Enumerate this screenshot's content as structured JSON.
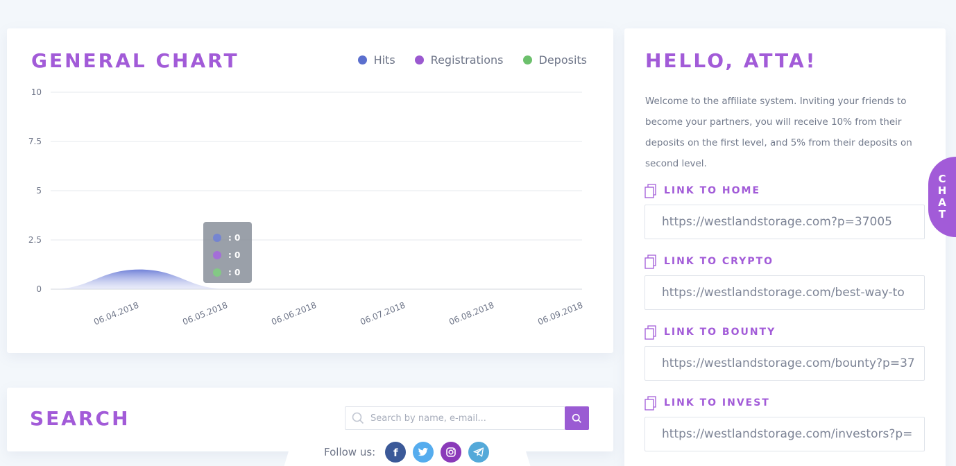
{
  "chart_card": {
    "title": "GENERAL CHART",
    "legend": [
      {
        "label": "Hits",
        "color": "#5b6fce"
      },
      {
        "label": "Registrations",
        "color": "#9b59d0"
      },
      {
        "label": "Deposits",
        "color": "#6cc06c"
      }
    ],
    "tooltip": [
      {
        "text": ": 0",
        "color": "#6f80d8"
      },
      {
        "text": ": 0",
        "color": "#a665e0"
      },
      {
        "text": ": 0",
        "color": "#7fd07f"
      }
    ]
  },
  "chart_data": {
    "type": "area",
    "title": "GENERAL CHART",
    "x": [
      "06.04.2018",
      "06.05.2018",
      "06.06.2018",
      "06.07.2018",
      "06.08.2018",
      "06.09.2018"
    ],
    "y_ticks": [
      "10",
      "7.5",
      "5",
      "2.5",
      "0"
    ],
    "ylim": [
      0,
      10
    ],
    "grid": true,
    "legend_position": "top-right",
    "series": [
      {
        "name": "Hits",
        "color": "#5b6fce",
        "values": [
          1,
          0,
          0,
          0,
          0,
          0
        ]
      },
      {
        "name": "Registrations",
        "color": "#9b59d0",
        "values": [
          0,
          0,
          0,
          0,
          0,
          0
        ]
      },
      {
        "name": "Deposits",
        "color": "#6cc06c",
        "values": [
          0,
          0,
          0,
          0,
          0,
          0
        ]
      }
    ]
  },
  "search_card": {
    "title": "SEARCH",
    "placeholder": "Search by name, e-mail..."
  },
  "follow": {
    "label": "Follow us:",
    "icons": [
      {
        "name": "facebook-icon",
        "color": "#3b5998"
      },
      {
        "name": "twitter-icon",
        "color": "#55acee"
      },
      {
        "name": "instagram-icon",
        "color": "#8a3ab9"
      },
      {
        "name": "telegram-icon",
        "color": "#54a9d9"
      }
    ]
  },
  "hello_card": {
    "title": "HELLO, ATTA!",
    "welcome": "Welcome to the affiliate system. Inviting your friends to become your partners, you will receive 10% from their deposits on the first level, and 5% from their deposits on second level.",
    "links": [
      {
        "label": "LINK TO HOME",
        "value": "https://westlandstorage.com?p=37005"
      },
      {
        "label": "LINK TO CRYPTO",
        "value": "https://westlandstorage.com/best-way-to"
      },
      {
        "label": "LINK TO BOUNTY",
        "value": "https://westlandstorage.com/bounty?p=37"
      },
      {
        "label": "LINK TO INVEST",
        "value": "https://westlandstorage.com/investors?p="
      }
    ]
  },
  "chat": {
    "label": [
      "C",
      "H",
      "A",
      "T"
    ]
  },
  "colors": {
    "accent": "#a25bd8",
    "background": "#f3f7fb"
  }
}
